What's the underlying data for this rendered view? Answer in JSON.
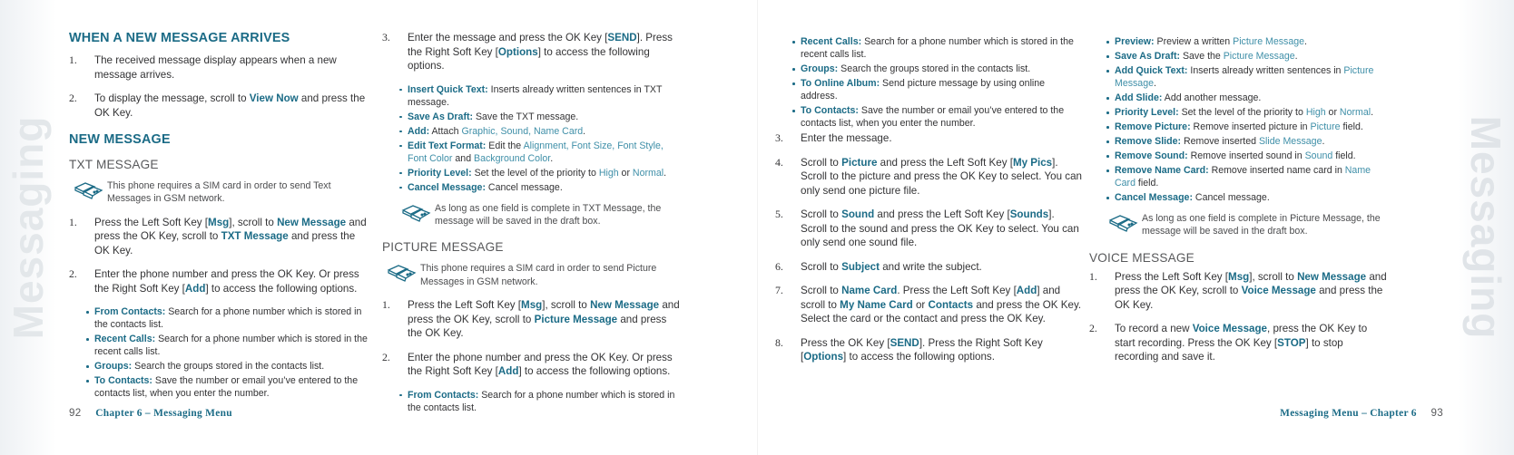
{
  "side_tabs": {
    "left_label": "Messaging",
    "right_label": "Messaging"
  },
  "left_page": {
    "column1": {
      "heading_arrives": "WHEN A NEW MESSAGE ARRIVES",
      "steps_arrives": [
        {
          "num": "1.",
          "parts": [
            {
              "t": "The received message display appears when a new message arrives.",
              "s": "n"
            }
          ]
        },
        {
          "num": "2.",
          "parts": [
            {
              "t": "To display the message, scroll to ",
              "s": "n"
            },
            {
              "t": "View Now",
              "s": "b"
            },
            {
              "t": " and press the OK Key.",
              "s": "n"
            }
          ]
        }
      ],
      "heading_new_message": "NEW MESSAGE",
      "heading_txt_message": "TXT MESSAGE",
      "note_sim": "This phone requires a SIM card in order to send Text Messages in GSM network.",
      "steps_txt": [
        {
          "num": "1.",
          "parts": [
            {
              "t": "Press the Left Soft Key [",
              "s": "n"
            },
            {
              "t": "Msg",
              "s": "b"
            },
            {
              "t": "], scroll to ",
              "s": "n"
            },
            {
              "t": "New Message",
              "s": "b"
            },
            {
              "t": " and press the OK Key, scroll to ",
              "s": "n"
            },
            {
              "t": "TXT Message",
              "s": "b"
            },
            {
              "t": " and press the OK Key.",
              "s": "n"
            }
          ]
        },
        {
          "num": "2.",
          "parts": [
            {
              "t": "Enter the phone number and press the OK Key. Or press the Right Soft Key [",
              "s": "n"
            },
            {
              "t": "Add",
              "s": "b"
            },
            {
              "t": "] to access the following options.",
              "s": "n"
            }
          ]
        }
      ],
      "bullets_add": [
        {
          "label": "From Contacts:",
          "text": " Search for a phone number which is stored in the contacts list."
        },
        {
          "label": "Recent Calls:",
          "text": " Search for a phone number which is stored in the recent calls list."
        },
        {
          "label": "Groups:",
          "text": " Search the groups stored in the contacts list."
        },
        {
          "label": "To Contacts:",
          "text": " Save the number or email you’ve entered to the contacts list, when you enter the number."
        }
      ]
    },
    "column2": {
      "step3": {
        "num": "3.",
        "parts": [
          {
            "t": "Enter the message and press the OK Key [",
            "s": "n"
          },
          {
            "t": "SEND",
            "s": "b"
          },
          {
            "t": "]. Press the Right Soft Key [",
            "s": "n"
          },
          {
            "t": "Options",
            "s": "b"
          },
          {
            "t": "] to access the following options.",
            "s": "n"
          }
        ]
      },
      "bullets_options": [
        {
          "label": "Insert Quick Text:",
          "text": " Inserts already written sentences in TXT message."
        },
        {
          "label": "Save As Draft:",
          "text": " Save the TXT message."
        },
        {
          "label": "Add:",
          "text": " Attach ",
          "light": "Graphic, Sound, Name Card",
          "tail": "."
        },
        {
          "label": "Edit Text Format:",
          "text": " Edit the ",
          "light": "Alignment, Font Size, Font Style, Font Color",
          "tail2": " and ",
          "light2": "Background Color",
          "tail": "."
        },
        {
          "label": "Priority Level:",
          "text": " Set the level of the priority to ",
          "light": "High",
          "tail2": " or ",
          "light2": "Normal",
          "tail": "."
        },
        {
          "label": "Cancel Message:",
          "text": " Cancel message."
        }
      ],
      "note_draft": "As long as one field is complete in TXT Message, the message will be saved in the draft box.",
      "heading_picture_message": "PICTURE MESSAGE",
      "note_sim_picture": "This phone requires a SIM card in order to send Picture Messages in GSM network.",
      "steps_picture": [
        {
          "num": "1.",
          "parts": [
            {
              "t": "Press the Left Soft Key [",
              "s": "n"
            },
            {
              "t": "Msg",
              "s": "b"
            },
            {
              "t": "], scroll to ",
              "s": "n"
            },
            {
              "t": "New Message",
              "s": "b"
            },
            {
              "t": " and press the OK Key, scroll to ",
              "s": "n"
            },
            {
              "t": "Picture Message",
              "s": "b"
            },
            {
              "t": " and press the OK Key.",
              "s": "n"
            }
          ]
        },
        {
          "num": "2.",
          "parts": [
            {
              "t": "Enter the phone number and press the OK Key. Or press the Right Soft Key [",
              "s": "n"
            },
            {
              "t": "Add",
              "s": "b"
            },
            {
              "t": "] to access the following options.",
              "s": "n"
            }
          ]
        }
      ],
      "bullet_from_contacts": {
        "label": "From Contacts:",
        "text": " Search for a phone number which is stored in the contacts list."
      }
    },
    "footer": {
      "page_number": "92",
      "text": "Chapter 6 – Messaging Menu"
    }
  },
  "right_page": {
    "column3": {
      "bullets_add_cont": [
        {
          "label": "Recent Calls:",
          "text": " Search for a phone number which is stored in the recent calls list."
        },
        {
          "label": "Groups:",
          "text": " Search the groups stored in the contacts list."
        },
        {
          "label": "To Online Album:",
          "text": " Send picture message by using online address."
        },
        {
          "label": "To Contacts:",
          "text": " Save the number or email you’ve entered to the contacts list, when you enter the number."
        }
      ],
      "steps": [
        {
          "num": "3.",
          "parts": [
            {
              "t": "Enter the message.",
              "s": "n"
            }
          ]
        },
        {
          "num": "4.",
          "parts": [
            {
              "t": "Scroll to ",
              "s": "n"
            },
            {
              "t": "Picture",
              "s": "b"
            },
            {
              "t": " and press the Left Soft Key [",
              "s": "n"
            },
            {
              "t": "My Pics",
              "s": "b"
            },
            {
              "t": "]. Scroll to the picture and press the OK Key to select. You can only send one picture file.",
              "s": "n"
            }
          ]
        },
        {
          "num": "5.",
          "parts": [
            {
              "t": "Scroll to ",
              "s": "n"
            },
            {
              "t": "Sound",
              "s": "b"
            },
            {
              "t": " and press the Left Soft Key [",
              "s": "n"
            },
            {
              "t": "Sounds",
              "s": "b"
            },
            {
              "t": "]. Scroll to the sound and press the OK Key to select. You can only send one sound file.",
              "s": "n"
            }
          ]
        },
        {
          "num": "6.",
          "parts": [
            {
              "t": "Scroll to ",
              "s": "n"
            },
            {
              "t": "Subject",
              "s": "b"
            },
            {
              "t": " and write the subject.",
              "s": "n"
            }
          ]
        },
        {
          "num": "7.",
          "parts": [
            {
              "t": "Scroll to ",
              "s": "n"
            },
            {
              "t": "Name Card",
              "s": "b"
            },
            {
              "t": ". Press the Left Soft Key [",
              "s": "n"
            },
            {
              "t": "Add",
              "s": "b"
            },
            {
              "t": "] and scroll to ",
              "s": "n"
            },
            {
              "t": "My Name Card",
              "s": "b"
            },
            {
              "t": " or ",
              "s": "n"
            },
            {
              "t": "Contacts",
              "s": "b"
            },
            {
              "t": " and press the OK Key. Select the card or the contact and press the OK Key.",
              "s": "n"
            }
          ]
        },
        {
          "num": "8.",
          "parts": [
            {
              "t": "Press the OK Key [",
              "s": "n"
            },
            {
              "t": "SEND",
              "s": "b"
            },
            {
              "t": "]. Press the Right Soft Key [",
              "s": "n"
            },
            {
              "t": "Options",
              "s": "b"
            },
            {
              "t": "] to access the following options.",
              "s": "n"
            }
          ]
        }
      ]
    },
    "column4": {
      "bullets_options": [
        {
          "label": "Preview:",
          "text": " Preview a written ",
          "light": "Picture Message",
          "tail": "."
        },
        {
          "label": "Save As Draft:",
          "text": " Save the ",
          "light": "Picture Message",
          "tail": "."
        },
        {
          "label": "Add Quick Text:",
          "text": " Inserts already written sentences in ",
          "light": "Picture Message",
          "tail": "."
        },
        {
          "label": "Add Slide:",
          "text": " Add another message."
        },
        {
          "label": "Priority Level:",
          "text": " Set the level of the priority to ",
          "light": "High",
          "tail2": " or ",
          "light2": "Normal",
          "tail": "."
        },
        {
          "label": "Remove Picture:",
          "text": " Remove inserted picture in ",
          "light": "Picture",
          "tail": " field."
        },
        {
          "label": "Remove Slide:",
          "text": " Remove inserted ",
          "light": "Slide Message",
          "tail": "."
        },
        {
          "label": "Remove Sound:",
          "text": " Remove inserted sound in ",
          "light": "Sound",
          "tail": " field."
        },
        {
          "label": "Remove Name Card:",
          "text": " Remove inserted name card in ",
          "light": "Name Card",
          "tail": " field."
        },
        {
          "label": "Cancel Message:",
          "text": " Cancel message."
        }
      ],
      "note_draft": "As long as one field is complete in Picture Message, the message will be saved in the draft box.",
      "heading_voice_message": "VOICE MESSAGE",
      "steps_voice": [
        {
          "num": "1.",
          "parts": [
            {
              "t": "Press the Left Soft Key [",
              "s": "n"
            },
            {
              "t": "Msg",
              "s": "b"
            },
            {
              "t": "], scroll to ",
              "s": "n"
            },
            {
              "t": "New Message",
              "s": "b"
            },
            {
              "t": " and press the OK Key, scroll to ",
              "s": "n"
            },
            {
              "t": "Voice Message",
              "s": "b"
            },
            {
              "t": " and press the OK Key.",
              "s": "n"
            }
          ]
        },
        {
          "num": "2.",
          "parts": [
            {
              "t": "To record a new ",
              "s": "n"
            },
            {
              "t": "Voice Message",
              "s": "b"
            },
            {
              "t": ", press the OK Key to start recording. Press the OK Key [",
              "s": "n"
            },
            {
              "t": "STOP",
              "s": "b"
            },
            {
              "t": "] to stop recording and save it.",
              "s": "n"
            }
          ]
        }
      ]
    },
    "footer": {
      "page_number": "93",
      "text": "Messaging Menu – Chapter 6"
    }
  },
  "colors": {
    "accent": "#1b6b86",
    "accent_light": "#3f8fa8",
    "body_text": "#333335",
    "heading_gray": "#58595b"
  }
}
